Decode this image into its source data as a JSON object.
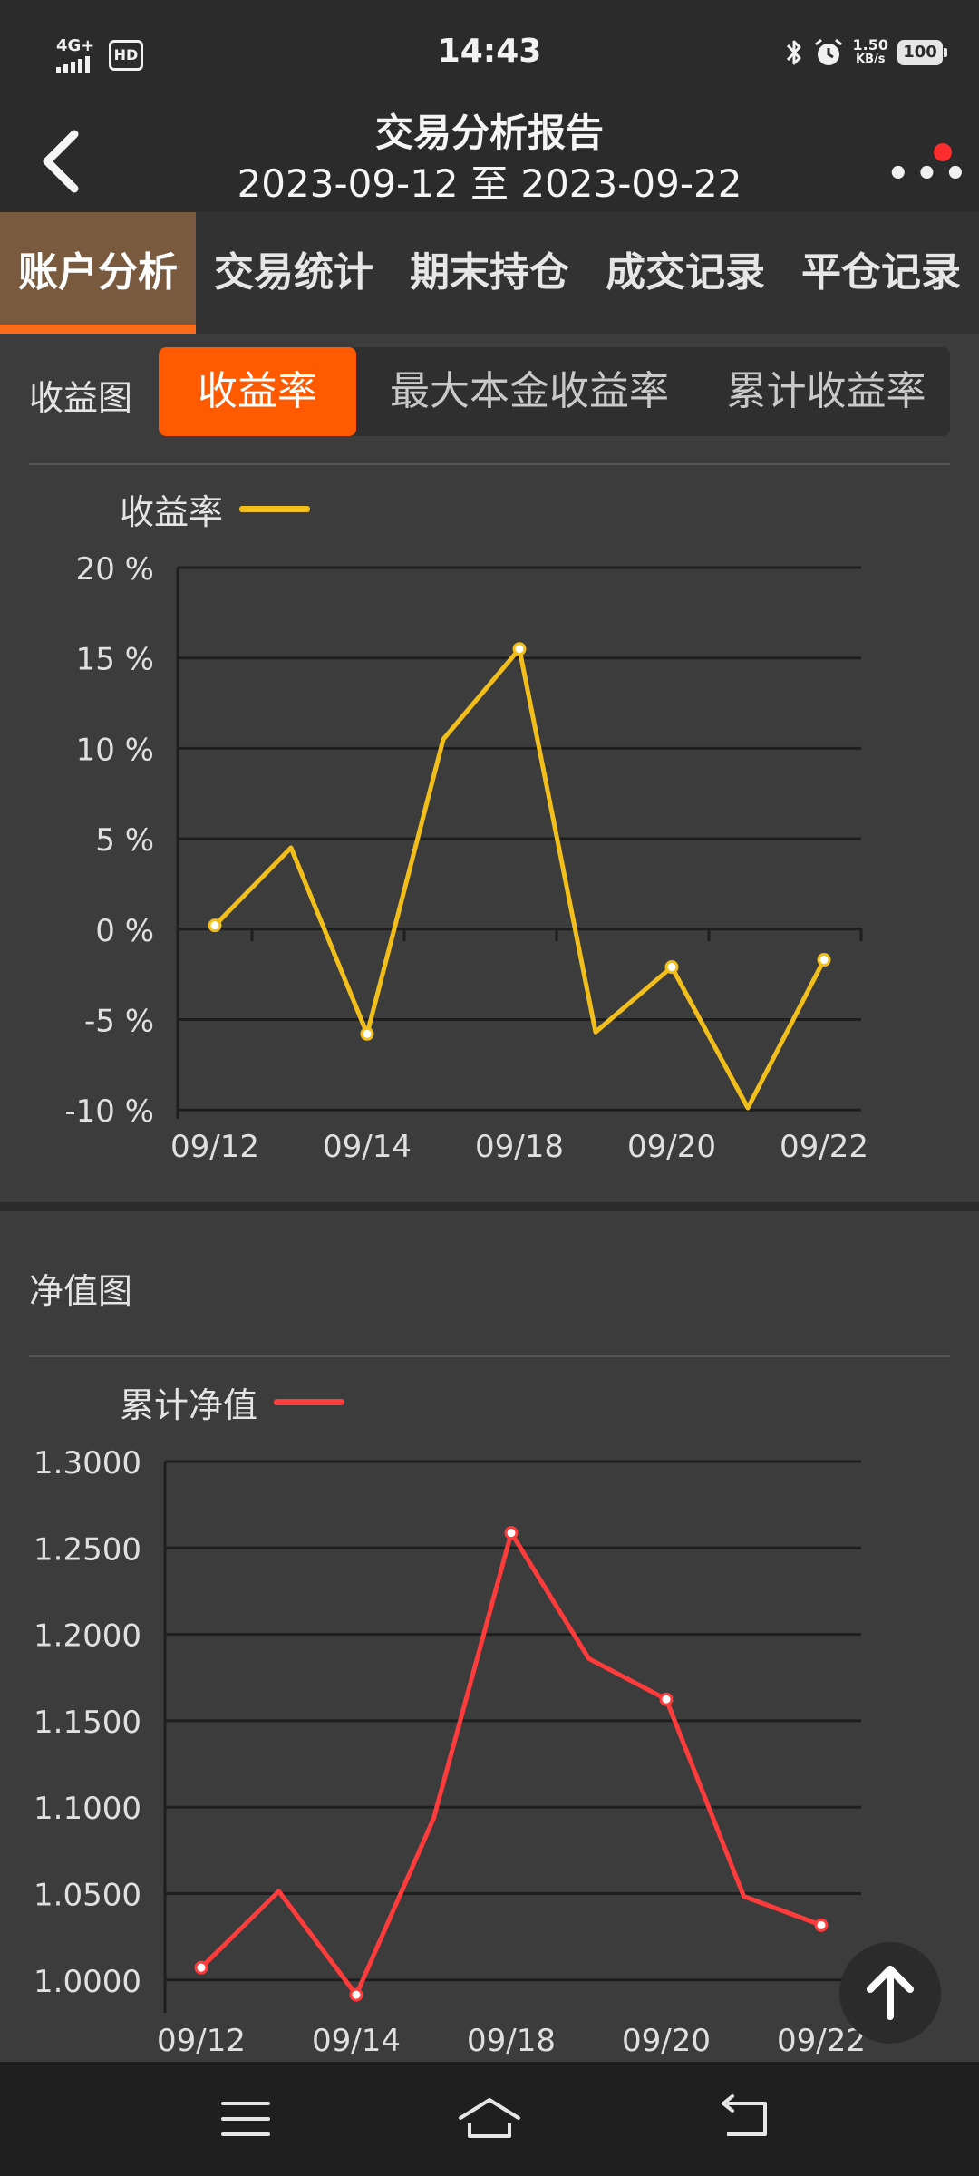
{
  "status_bar": {
    "time": "14:43",
    "network": "4G+",
    "hd": "HD",
    "speed_value": "1.50",
    "speed_unit": "KB/s",
    "battery": "100"
  },
  "header": {
    "title": "交易分析报告",
    "date_range": "2023-09-12 至 2023-09-22"
  },
  "tabs": [
    {
      "label": "账户分析",
      "active": true
    },
    {
      "label": "交易统计",
      "active": false
    },
    {
      "label": "期末持仓",
      "active": false
    },
    {
      "label": "成交记录",
      "active": false
    },
    {
      "label": "平仓记录",
      "active": false
    }
  ],
  "returns_section": {
    "label": "收益图",
    "segments": [
      {
        "label": "收益率",
        "active": true
      },
      {
        "label": "最大本金收益率",
        "active": false
      },
      {
        "label": "累计收益率",
        "active": false
      }
    ]
  },
  "nav_section": {
    "label": "净值图"
  },
  "colors": {
    "accent": "#ff5a00",
    "return_line": "#f2be1a",
    "nav_line": "#ff3b3b"
  },
  "chart_data": [
    {
      "type": "line",
      "legend": "收益率",
      "x_tick_labels": [
        "09/12",
        "09/14",
        "09/18",
        "09/20",
        "09/22"
      ],
      "y_tick_labels": [
        "20 %",
        "15 %",
        "10 %",
        "5 %",
        "0 %",
        "-5 %",
        "-10 %"
      ],
      "ylim": [
        -10,
        20
      ],
      "x": [
        0,
        1,
        2,
        3,
        4,
        5,
        6,
        7,
        8
      ],
      "values": [
        0.2,
        4.5,
        -5.8,
        10.5,
        15.5,
        -5.7,
        -2.1,
        -9.9,
        -1.7
      ],
      "marked_points": [
        0,
        2,
        4,
        6,
        8
      ]
    },
    {
      "type": "line",
      "legend": "累计净值",
      "x_tick_labels": [
        "09/12",
        "09/14",
        "09/18",
        "09/20",
        "09/22"
      ],
      "y_tick_labels": [
        "1.3000",
        "1.2500",
        "1.2000",
        "1.1500",
        "1.1000",
        "1.0500",
        "1.0000"
      ],
      "ylim": [
        0.985,
        1.3
      ],
      "x": [
        0,
        1,
        2,
        3,
        4,
        5,
        6,
        7,
        8
      ],
      "values": [
        1.002,
        1.047,
        0.986,
        1.09,
        1.258,
        1.184,
        1.16,
        1.044,
        1.027
      ],
      "marked_points": [
        0,
        2,
        4,
        6,
        8
      ]
    }
  ],
  "icons": {
    "back": "chevron-left-icon",
    "more": "more-icon",
    "scroll_top": "arrow-up-icon",
    "menu": "menu-icon",
    "home": "home-icon",
    "back_nav": "back-nav-icon"
  }
}
